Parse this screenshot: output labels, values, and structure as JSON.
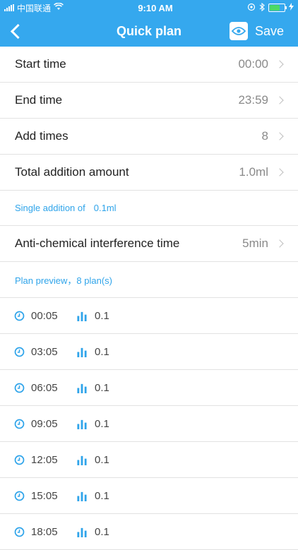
{
  "status": {
    "carrier": "中国联通",
    "time": "9:10 AM",
    "battery_level": 0.75,
    "battery_color": "#4cd964"
  },
  "nav": {
    "title": "Quick plan",
    "save_label": "Save",
    "back_icon": "chevron-left-icon",
    "eye_icon": "eye-icon"
  },
  "settings": [
    {
      "label": "Start time",
      "value": "00:00"
    },
    {
      "label": "End time",
      "value": "23:59"
    },
    {
      "label": "Add times",
      "value": "8"
    },
    {
      "label": "Total addition amount",
      "value": "1.0ml"
    }
  ],
  "single_note": {
    "label": "Single addition of",
    "value": "0.1ml"
  },
  "anti": {
    "label": "Anti-chemical interference time",
    "value": "5min"
  },
  "preview": {
    "heading": "Plan preview，8 plan(s)",
    "items": [
      {
        "time": "00:05",
        "amount": "0.1"
      },
      {
        "time": "03:05",
        "amount": "0.1"
      },
      {
        "time": "06:05",
        "amount": "0.1"
      },
      {
        "time": "09:05",
        "amount": "0.1"
      },
      {
        "time": "12:05",
        "amount": "0.1"
      },
      {
        "time": "15:05",
        "amount": "0.1"
      },
      {
        "time": "18:05",
        "amount": "0.1"
      }
    ]
  },
  "colors": {
    "header": "#35a8ee",
    "accent": "#2fa4ea"
  }
}
